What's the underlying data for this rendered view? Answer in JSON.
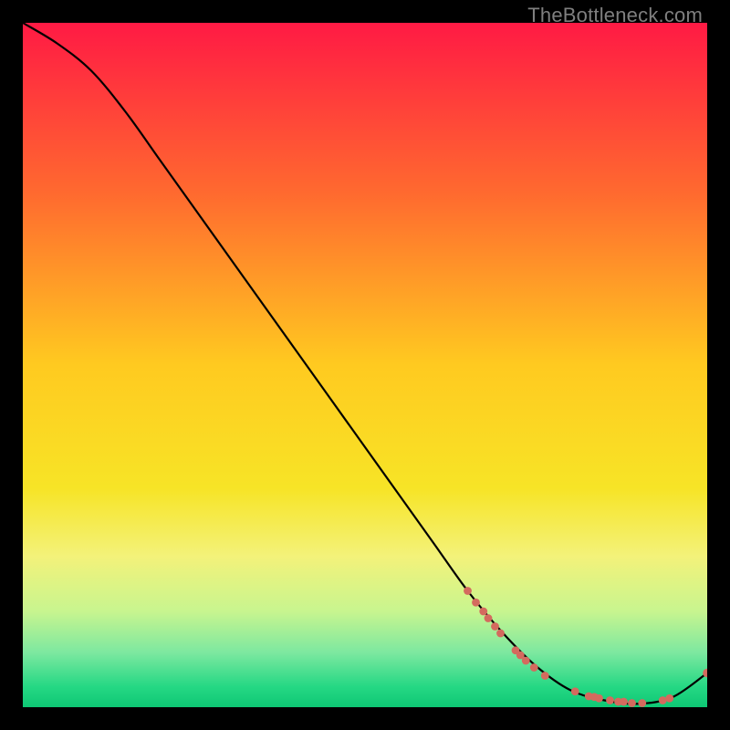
{
  "watermark": "TheBottleneck.com",
  "chart_data": {
    "type": "line",
    "title": "",
    "xlabel": "",
    "ylabel": "",
    "xlim": [
      0,
      100
    ],
    "ylim": [
      0,
      100
    ],
    "gradient_stops": [
      {
        "offset": 0,
        "color": "#ff1a44"
      },
      {
        "offset": 25,
        "color": "#ff6a2f"
      },
      {
        "offset": 50,
        "color": "#ffca20"
      },
      {
        "offset": 68,
        "color": "#f7e426"
      },
      {
        "offset": 78,
        "color": "#f3f27a"
      },
      {
        "offset": 86,
        "color": "#c8f58f"
      },
      {
        "offset": 92,
        "color": "#7de8a0"
      },
      {
        "offset": 97,
        "color": "#25d884"
      },
      {
        "offset": 100,
        "color": "#0ec774"
      }
    ],
    "series": [
      {
        "name": "bottleneck-curve",
        "x": [
          0,
          5,
          10,
          15,
          20,
          25,
          30,
          35,
          40,
          45,
          50,
          55,
          60,
          65,
          70,
          75,
          80,
          85,
          90,
          95,
          100
        ],
        "y": [
          100,
          97,
          93,
          87,
          80,
          73,
          66,
          59,
          52,
          45,
          38,
          31,
          24,
          17,
          11,
          6,
          2.5,
          1,
          0.5,
          1.5,
          5
        ]
      }
    ],
    "markers": {
      "name": "data-points",
      "color": "#d46a5e",
      "x_y_r": [
        [
          65.0,
          17.0,
          4.4
        ],
        [
          66.2,
          15.3,
          4.4
        ],
        [
          67.3,
          14.0,
          4.4
        ],
        [
          68.0,
          13.0,
          4.4
        ],
        [
          69.0,
          11.8,
          4.4
        ],
        [
          69.8,
          10.8,
          4.4
        ],
        [
          72.0,
          8.3,
          4.4
        ],
        [
          72.7,
          7.6,
          4.4
        ],
        [
          73.5,
          6.8,
          4.4
        ],
        [
          74.7,
          5.8,
          4.4
        ],
        [
          76.3,
          4.6,
          4.4
        ],
        [
          80.7,
          2.3,
          4.4
        ],
        [
          82.7,
          1.6,
          4.4
        ],
        [
          83.5,
          1.5,
          4.4
        ],
        [
          84.2,
          1.3,
          4.4
        ],
        [
          85.8,
          1.0,
          4.4
        ],
        [
          87.0,
          0.8,
          4.4
        ],
        [
          87.8,
          0.8,
          4.4
        ],
        [
          89.0,
          0.6,
          4.4
        ],
        [
          90.5,
          0.6,
          4.4
        ],
        [
          93.5,
          1.0,
          4.4
        ],
        [
          94.5,
          1.3,
          4.4
        ],
        [
          100.0,
          5.0,
          4.8
        ]
      ]
    }
  }
}
